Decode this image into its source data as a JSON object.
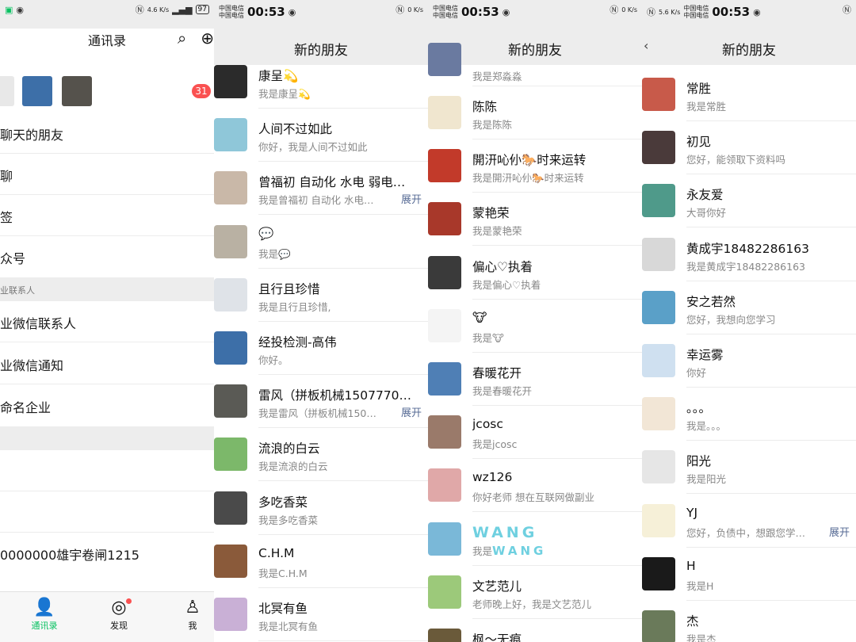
{
  "panel1": {
    "status": {
      "net_speed": "4.6 K/s",
      "battery": "97"
    },
    "title": "通讯录",
    "badge": "31",
    "items": [
      {
        "label": "聊天的朋友"
      },
      {
        "label": "聊"
      },
      {
        "label": "签"
      },
      {
        "label": "众号"
      }
    ],
    "section_label": "业联系人",
    "items2": [
      {
        "label": "业微信联系人"
      },
      {
        "label": "业微信通知"
      },
      {
        "label": "命名企业"
      }
    ],
    "items3": [
      {
        "label": ""
      },
      {
        "label": ""
      },
      {
        "label": "0000000雄宇卷闸1215"
      }
    ],
    "tabs": [
      {
        "label": "通讯录",
        "icon": "contacts-icon"
      },
      {
        "label": "发现",
        "icon": "compass-icon"
      },
      {
        "label": "我",
        "icon": "person-icon"
      }
    ]
  },
  "panel2": {
    "status": {
      "carrier1": "中国电信",
      "carrier2": "中国电信",
      "time": "00:53",
      "net_speed": "0 K/s"
    },
    "title": "新的朋友",
    "expand_label": "展开",
    "friends": [
      {
        "name": "康呈💫",
        "msg": "我是康呈💫",
        "color": "#2b2b2b",
        "expand": false
      },
      {
        "name": "人间不过如此",
        "msg": "你好，我是人间不过如此",
        "color": "#8fc7d9",
        "expand": false
      },
      {
        "name": "曾福初 自动化 水电 弱电…",
        "msg": "我是曾福初 自动化 水电…",
        "color": "#c9b8a8",
        "expand": true
      },
      {
        "name": "💬",
        "msg": "我是💬",
        "color": "#b9b1a3",
        "expand": false
      },
      {
        "name": "且行且珍惜",
        "msg": "我是且行且珍惜,",
        "color": "#dfe3e8",
        "expand": false
      },
      {
        "name": "经投检测-高伟",
        "msg": "你好。",
        "color": "#3d6fa8",
        "expand": false
      },
      {
        "name": "雷风（拼板机械1507770…",
        "msg": "我是雷风（拼板机械1507…",
        "color": "#5a5a55",
        "expand": true
      },
      {
        "name": "流浪的白云",
        "msg": "我是流浪的白云",
        "color": "#7cb86a",
        "expand": false
      },
      {
        "name": "多吃香菜",
        "msg": "我是多吃香菜",
        "color": "#4a4a4a",
        "expand": false
      },
      {
        "name": "C.H.M",
        "msg": "我是C.H.M",
        "color": "#8a5a3a",
        "expand": false
      },
      {
        "name": "北冥有鱼",
        "msg": "我是北冥有鱼",
        "color": "#c9b0d6",
        "expand": false
      }
    ]
  },
  "panel3": {
    "status": {
      "carrier1": "中国电信",
      "carrier2": "中国电信",
      "time": "00:53",
      "net_speed": "0 K/s"
    },
    "title": "新的朋友",
    "top_partial_msg": "我是郑淼淼",
    "friends": [
      {
        "name": "陈陈",
        "msg": "我是陈陈",
        "color": "#f0e6cf"
      },
      {
        "name": "開汧吣仦🐎时来运转",
        "msg": "我是開汧吣仦🐎时来运转",
        "color": "#c23a2a"
      },
      {
        "name": "蒙艳荣",
        "msg": "我是蒙艳荣",
        "color": "#a8382a"
      },
      {
        "name": "偏心♡执着",
        "msg": "我是偏心♡执着",
        "color": "#3a3a3a"
      },
      {
        "name": "🐮",
        "msg": "我是🐮",
        "color": "#f4f4f4"
      },
      {
        "name": "春暖花开",
        "msg": "我是春暖花开",
        "color": "#4f7fb5"
      },
      {
        "name": "jcosc",
        "msg": "我是jcosc",
        "color": "#9a7a6a"
      },
      {
        "name": "wz126",
        "msg": "你好老师 想在互联网做副业",
        "color": "#e0a8a8"
      },
      {
        "name": "WANG",
        "msg": "我是",
        "msg_suffix": "WANG",
        "color": "#7ab8d8"
      },
      {
        "name": "文艺范儿",
        "msg": "老师晚上好，我是文艺范儿",
        "color": "#9cc97a"
      },
      {
        "name": "枫～无痕",
        "msg": "",
        "color": "#6a5a3a"
      }
    ]
  },
  "panel4": {
    "status": {
      "carrier1": "中国电信",
      "carrier2": "中国电信",
      "time": "00:53",
      "net_speed": "5.6 K/s"
    },
    "title": "新的朋友",
    "expand_label": "展开",
    "friends": [
      {
        "name": "常胜",
        "msg": "我是常胜",
        "color": "#c85a4a",
        "expand": false
      },
      {
        "name": "初见",
        "msg": "您好，能领取下资料吗",
        "color": "#4a3a3a",
        "expand": false
      },
      {
        "name": "永友爱",
        "msg": "大哥你好",
        "color": "#4f9a8a",
        "expand": false
      },
      {
        "name": "黄成宇18482286163",
        "msg": "我是黄成宇18482286163",
        "color": "#d8d8d8",
        "expand": false
      },
      {
        "name": "安之若然",
        "msg": "您好，我想向您学习",
        "color": "#5aa0c8",
        "expand": false
      },
      {
        "name": "幸运雾",
        "msg": "你好",
        "color": "#cfe0f0",
        "expand": false
      },
      {
        "name": "。。。",
        "msg": "我是。。。",
        "color": "#f2e6d6",
        "expand": false
      },
      {
        "name": "阳光",
        "msg": "我是阳光",
        "color": "#e6e6e6",
        "expand": false
      },
      {
        "name": "YJ",
        "msg": "您好，负债中，想跟您学…",
        "color": "#f6f0d8",
        "expand": true
      },
      {
        "name": "H",
        "msg": "我是H",
        "color": "#1a1a1a",
        "expand": false
      },
      {
        "name": "杰",
        "msg": "我是杰",
        "color": "#6a7a5a",
        "expand": false
      }
    ]
  }
}
